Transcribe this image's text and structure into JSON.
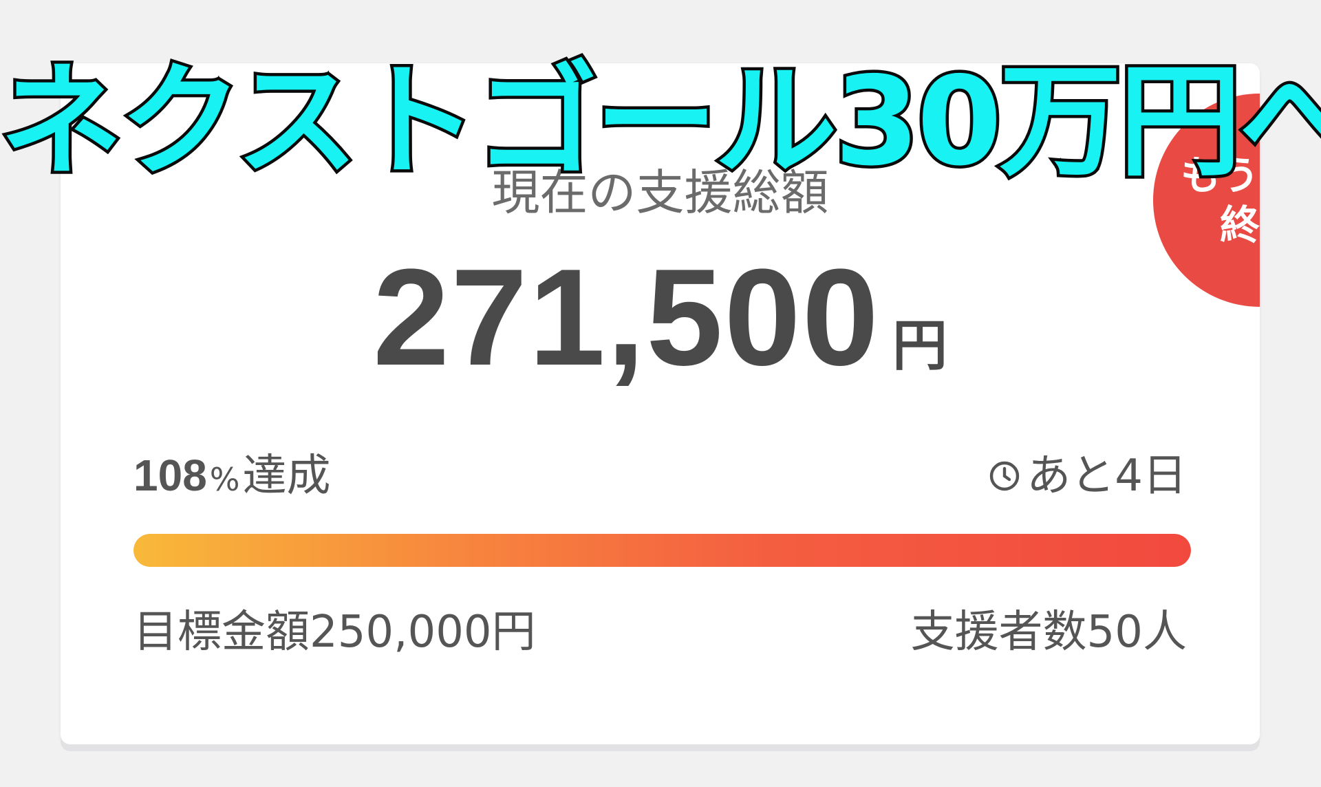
{
  "overlay": {
    "title": "ネクストゴール30万円へ"
  },
  "card": {
    "badge_line1": "もうすぐ",
    "badge_line2": "終了",
    "label": "現在の支援総額",
    "amount": "271,500",
    "amount_unit": "円",
    "achievement_number": "108",
    "achievement_symbol": "%",
    "achievement_text": "達成",
    "progress_percent": 108,
    "remaining_label": "あと4日",
    "goal_label": "目標金額250,000円",
    "supporters_label": "支援者数50人"
  },
  "colors": {
    "badge": "#ea4a44",
    "overlay_text": "#19f2f2",
    "progress_start": "#f8b93a",
    "progress_end": "#f2493f"
  },
  "icons": {
    "remaining": "clock-icon"
  }
}
